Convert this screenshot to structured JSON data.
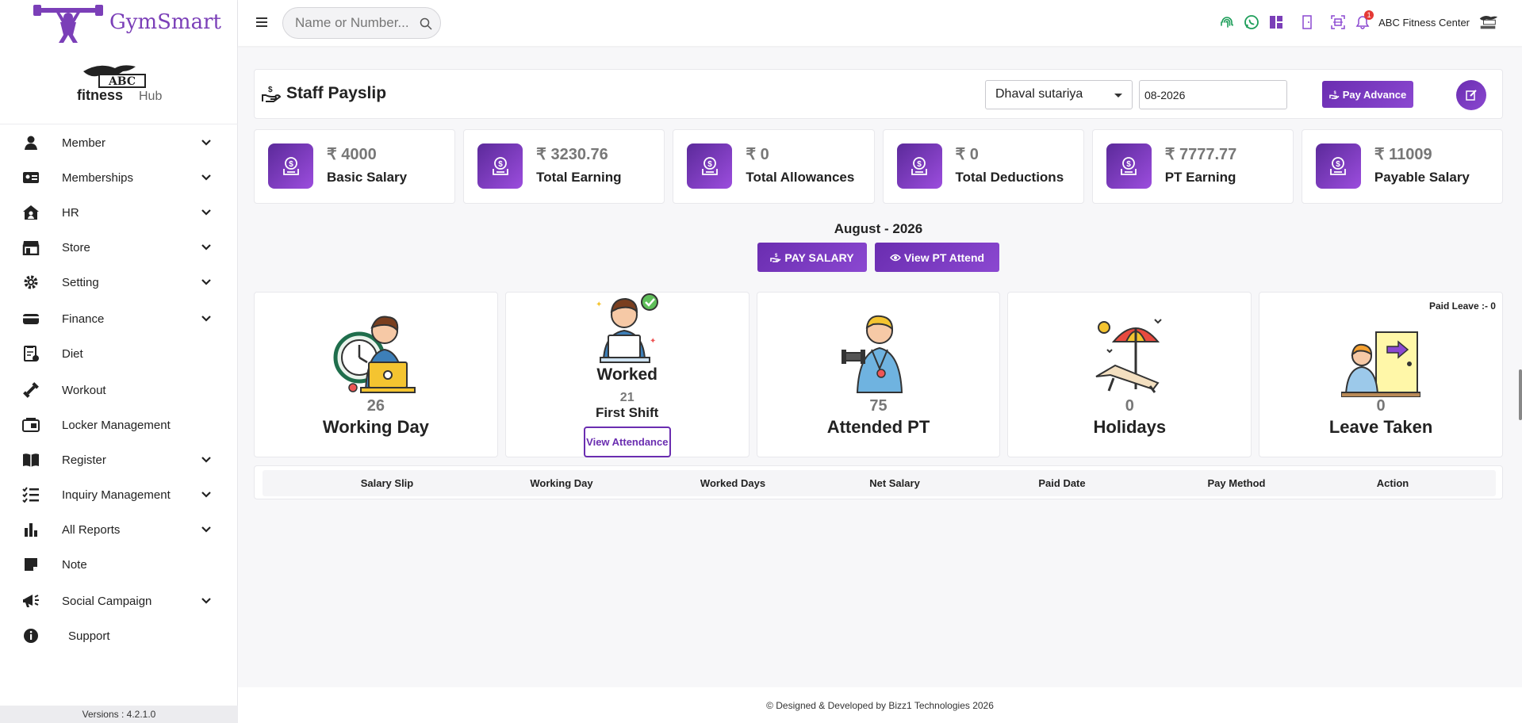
{
  "app": {
    "name": "GymSmart",
    "club_logo": {
      "line1": "ABC",
      "line2": "fitness",
      "line3": "Hub"
    },
    "version": "Versions : 4.2.1.0"
  },
  "topbar": {
    "search_placeholder": "Name or Number...",
    "center_name": "ABC Fitness Center",
    "notification_count": "1"
  },
  "sidebar": {
    "items": [
      {
        "label": "Member",
        "icon": "person-icon",
        "expandable": true
      },
      {
        "label": "Memberships",
        "icon": "id-card-icon",
        "expandable": true
      },
      {
        "label": "HR",
        "icon": "home-user-icon",
        "expandable": true
      },
      {
        "label": "Store",
        "icon": "store-icon",
        "expandable": true
      },
      {
        "label": "Setting",
        "icon": "gear-icon",
        "expandable": true
      },
      {
        "label": "Finance",
        "icon": "wallet-icon",
        "expandable": true
      },
      {
        "label": "Diet",
        "icon": "diet-icon",
        "expandable": false
      },
      {
        "label": "Workout",
        "icon": "dumbbell-icon",
        "expandable": false
      },
      {
        "label": "Locker Management",
        "icon": "locker-icon",
        "expandable": false
      },
      {
        "label": "Register",
        "icon": "book-icon",
        "expandable": true
      },
      {
        "label": "Inquiry Management",
        "icon": "checklist-icon",
        "expandable": true
      },
      {
        "label": "All Reports",
        "icon": "bar-chart-icon",
        "expandable": true
      },
      {
        "label": "Note",
        "icon": "note-icon",
        "expandable": false
      },
      {
        "label": "Social Campaign",
        "icon": "megaphone-icon",
        "expandable": true
      },
      {
        "label": "Support",
        "icon": "info-icon",
        "expandable": false
      }
    ]
  },
  "header": {
    "title": "Staff Payslip",
    "staff_selected": "Dhaval sutariya",
    "month_value": "08-2026",
    "pay_advance_label": "Pay Advance"
  },
  "stats": [
    {
      "amount": "₹ 4000",
      "label": "Basic Salary"
    },
    {
      "amount": "₹ 3230.76",
      "label": "Total Earning"
    },
    {
      "amount": "₹ 0",
      "label": "Total Allowances"
    },
    {
      "amount": "₹ 0",
      "label": "Total Deductions"
    },
    {
      "amount": "₹ 7777.77",
      "label": "PT Earning"
    },
    {
      "amount": "₹ 11009",
      "label": "Payable Salary"
    }
  ],
  "period": {
    "label": "August - 2026",
    "pay_salary_label": "PAY SALARY",
    "view_pt_label": "View PT Attend"
  },
  "tiles": {
    "working_day": {
      "value": "26",
      "label": "Working Day"
    },
    "worked": {
      "title": "Worked",
      "value": "21",
      "shift": "First Shift",
      "button": "View Attendance"
    },
    "attended_pt": {
      "value": "75",
      "label": "Attended PT"
    },
    "holidays": {
      "value": "0",
      "label": "Holidays"
    },
    "leave": {
      "value": "0",
      "label": "Leave Taken",
      "paid_leave": "Paid Leave :- 0"
    }
  },
  "table": {
    "columns": [
      "Salary Slip",
      "Working Day",
      "Worked Days",
      "Net Salary",
      "Paid Date",
      "Pay Method",
      "Action"
    ]
  },
  "footer": {
    "text": "© Designed & Developed by Bizz1 Technologies 2026"
  },
  "colors": {
    "accent": "#7b3fb8",
    "brand_text": "#7b3fb8",
    "badge": "#e53935"
  }
}
